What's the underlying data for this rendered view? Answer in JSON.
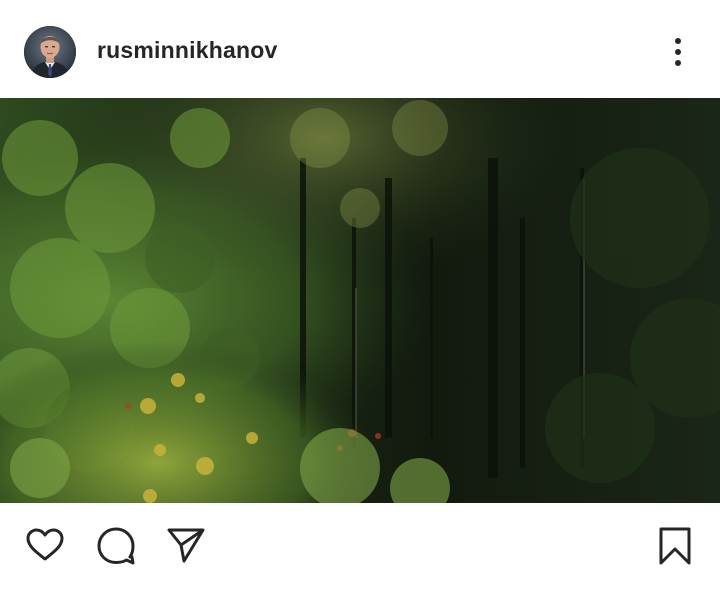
{
  "post": {
    "username": "rusminnikhanov"
  },
  "icons": {
    "avatar": "profile-photo",
    "more": "more-vertical-icon",
    "like": "heart-icon",
    "comment": "comment-icon",
    "share": "send-icon",
    "save": "bookmark-icon"
  },
  "colors": {
    "text": "#262626",
    "background": "#ffffff"
  }
}
